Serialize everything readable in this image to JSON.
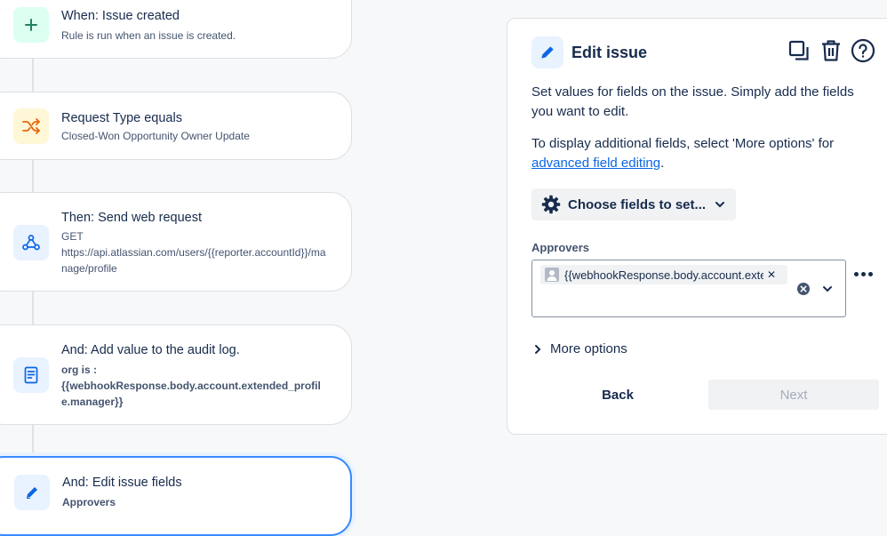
{
  "flow": {
    "trigger": {
      "title": "When: Issue created",
      "subtitle": "Rule is run when an issue is created."
    },
    "condition": {
      "title": "Request Type equals",
      "subtitle": "Closed-Won Opportunity Owner Update"
    },
    "webrequest": {
      "title": "Then: Send web request",
      "method": "GET",
      "url": "https://api.atlassian.com/users/{{reporter.accountId}}/manage/profile"
    },
    "auditlog": {
      "title": "And: Add value to the audit log.",
      "line1": "org is :",
      "line2": "{{webhookResponse.body.account.extended_profile.manager}}"
    },
    "edit": {
      "title": "And: Edit issue fields",
      "subtitle": "Approvers"
    }
  },
  "panel": {
    "title": "Edit issue",
    "desc1": "Set values for fields on the issue. Simply add the fields you want to edit.",
    "desc2_pre": "To display additional fields, select 'More options' for",
    "desc2_link": "advanced field editing",
    "desc2_post": ".",
    "choose_fields_label": "Choose fields to set...",
    "field_label": "Approvers",
    "chip_value": "{{webhookResponse.body.account.extended_profile.manager}}",
    "more_options_label": "More options",
    "back_label": "Back",
    "next_label": "Next"
  },
  "colors": {
    "accent": "#0c66e4",
    "trigger_bg": "#dcfff1",
    "condition_bg": "#fff7d6",
    "action_bg": "#e9f2ff"
  },
  "icons": [
    "plus-icon",
    "shuffle-icon",
    "webhook-icon",
    "document-icon",
    "pencil-icon",
    "copy-icon",
    "trash-icon",
    "help-icon",
    "gear-icon",
    "chevron-down-icon",
    "clear-icon",
    "more-icon",
    "chevron-right-icon",
    "user-avatar-icon"
  ]
}
